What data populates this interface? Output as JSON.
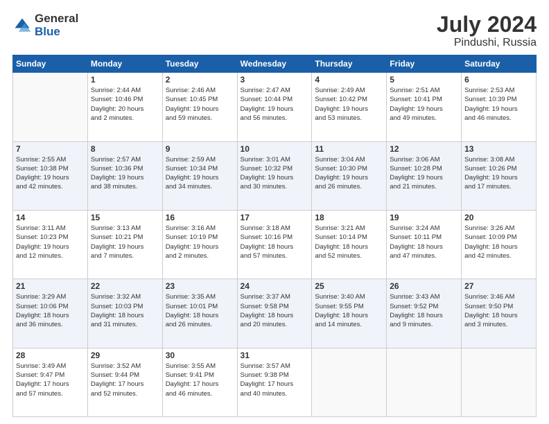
{
  "header": {
    "logo_general": "General",
    "logo_blue": "Blue",
    "title": "July 2024",
    "location": "Pindushi, Russia"
  },
  "days_of_week": [
    "Sunday",
    "Monday",
    "Tuesday",
    "Wednesday",
    "Thursday",
    "Friday",
    "Saturday"
  ],
  "weeks": [
    [
      {
        "day": "",
        "info": ""
      },
      {
        "day": "1",
        "info": "Sunrise: 2:44 AM\nSunset: 10:46 PM\nDaylight: 20 hours\nand 2 minutes."
      },
      {
        "day": "2",
        "info": "Sunrise: 2:46 AM\nSunset: 10:45 PM\nDaylight: 19 hours\nand 59 minutes."
      },
      {
        "day": "3",
        "info": "Sunrise: 2:47 AM\nSunset: 10:44 PM\nDaylight: 19 hours\nand 56 minutes."
      },
      {
        "day": "4",
        "info": "Sunrise: 2:49 AM\nSunset: 10:42 PM\nDaylight: 19 hours\nand 53 minutes."
      },
      {
        "day": "5",
        "info": "Sunrise: 2:51 AM\nSunset: 10:41 PM\nDaylight: 19 hours\nand 49 minutes."
      },
      {
        "day": "6",
        "info": "Sunrise: 2:53 AM\nSunset: 10:39 PM\nDaylight: 19 hours\nand 46 minutes."
      }
    ],
    [
      {
        "day": "7",
        "info": "Sunrise: 2:55 AM\nSunset: 10:38 PM\nDaylight: 19 hours\nand 42 minutes."
      },
      {
        "day": "8",
        "info": "Sunrise: 2:57 AM\nSunset: 10:36 PM\nDaylight: 19 hours\nand 38 minutes."
      },
      {
        "day": "9",
        "info": "Sunrise: 2:59 AM\nSunset: 10:34 PM\nDaylight: 19 hours\nand 34 minutes."
      },
      {
        "day": "10",
        "info": "Sunrise: 3:01 AM\nSunset: 10:32 PM\nDaylight: 19 hours\nand 30 minutes."
      },
      {
        "day": "11",
        "info": "Sunrise: 3:04 AM\nSunset: 10:30 PM\nDaylight: 19 hours\nand 26 minutes."
      },
      {
        "day": "12",
        "info": "Sunrise: 3:06 AM\nSunset: 10:28 PM\nDaylight: 19 hours\nand 21 minutes."
      },
      {
        "day": "13",
        "info": "Sunrise: 3:08 AM\nSunset: 10:26 PM\nDaylight: 19 hours\nand 17 minutes."
      }
    ],
    [
      {
        "day": "14",
        "info": "Sunrise: 3:11 AM\nSunset: 10:23 PM\nDaylight: 19 hours\nand 12 minutes."
      },
      {
        "day": "15",
        "info": "Sunrise: 3:13 AM\nSunset: 10:21 PM\nDaylight: 19 hours\nand 7 minutes."
      },
      {
        "day": "16",
        "info": "Sunrise: 3:16 AM\nSunset: 10:19 PM\nDaylight: 19 hours\nand 2 minutes."
      },
      {
        "day": "17",
        "info": "Sunrise: 3:18 AM\nSunset: 10:16 PM\nDaylight: 18 hours\nand 57 minutes."
      },
      {
        "day": "18",
        "info": "Sunrise: 3:21 AM\nSunset: 10:14 PM\nDaylight: 18 hours\nand 52 minutes."
      },
      {
        "day": "19",
        "info": "Sunrise: 3:24 AM\nSunset: 10:11 PM\nDaylight: 18 hours\nand 47 minutes."
      },
      {
        "day": "20",
        "info": "Sunrise: 3:26 AM\nSunset: 10:09 PM\nDaylight: 18 hours\nand 42 minutes."
      }
    ],
    [
      {
        "day": "21",
        "info": "Sunrise: 3:29 AM\nSunset: 10:06 PM\nDaylight: 18 hours\nand 36 minutes."
      },
      {
        "day": "22",
        "info": "Sunrise: 3:32 AM\nSunset: 10:03 PM\nDaylight: 18 hours\nand 31 minutes."
      },
      {
        "day": "23",
        "info": "Sunrise: 3:35 AM\nSunset: 10:01 PM\nDaylight: 18 hours\nand 26 minutes."
      },
      {
        "day": "24",
        "info": "Sunrise: 3:37 AM\nSunset: 9:58 PM\nDaylight: 18 hours\nand 20 minutes."
      },
      {
        "day": "25",
        "info": "Sunrise: 3:40 AM\nSunset: 9:55 PM\nDaylight: 18 hours\nand 14 minutes."
      },
      {
        "day": "26",
        "info": "Sunrise: 3:43 AM\nSunset: 9:52 PM\nDaylight: 18 hours\nand 9 minutes."
      },
      {
        "day": "27",
        "info": "Sunrise: 3:46 AM\nSunset: 9:50 PM\nDaylight: 18 hours\nand 3 minutes."
      }
    ],
    [
      {
        "day": "28",
        "info": "Sunrise: 3:49 AM\nSunset: 9:47 PM\nDaylight: 17 hours\nand 57 minutes."
      },
      {
        "day": "29",
        "info": "Sunrise: 3:52 AM\nSunset: 9:44 PM\nDaylight: 17 hours\nand 52 minutes."
      },
      {
        "day": "30",
        "info": "Sunrise: 3:55 AM\nSunset: 9:41 PM\nDaylight: 17 hours\nand 46 minutes."
      },
      {
        "day": "31",
        "info": "Sunrise: 3:57 AM\nSunset: 9:38 PM\nDaylight: 17 hours\nand 40 minutes."
      },
      {
        "day": "",
        "info": ""
      },
      {
        "day": "",
        "info": ""
      },
      {
        "day": "",
        "info": ""
      }
    ]
  ]
}
